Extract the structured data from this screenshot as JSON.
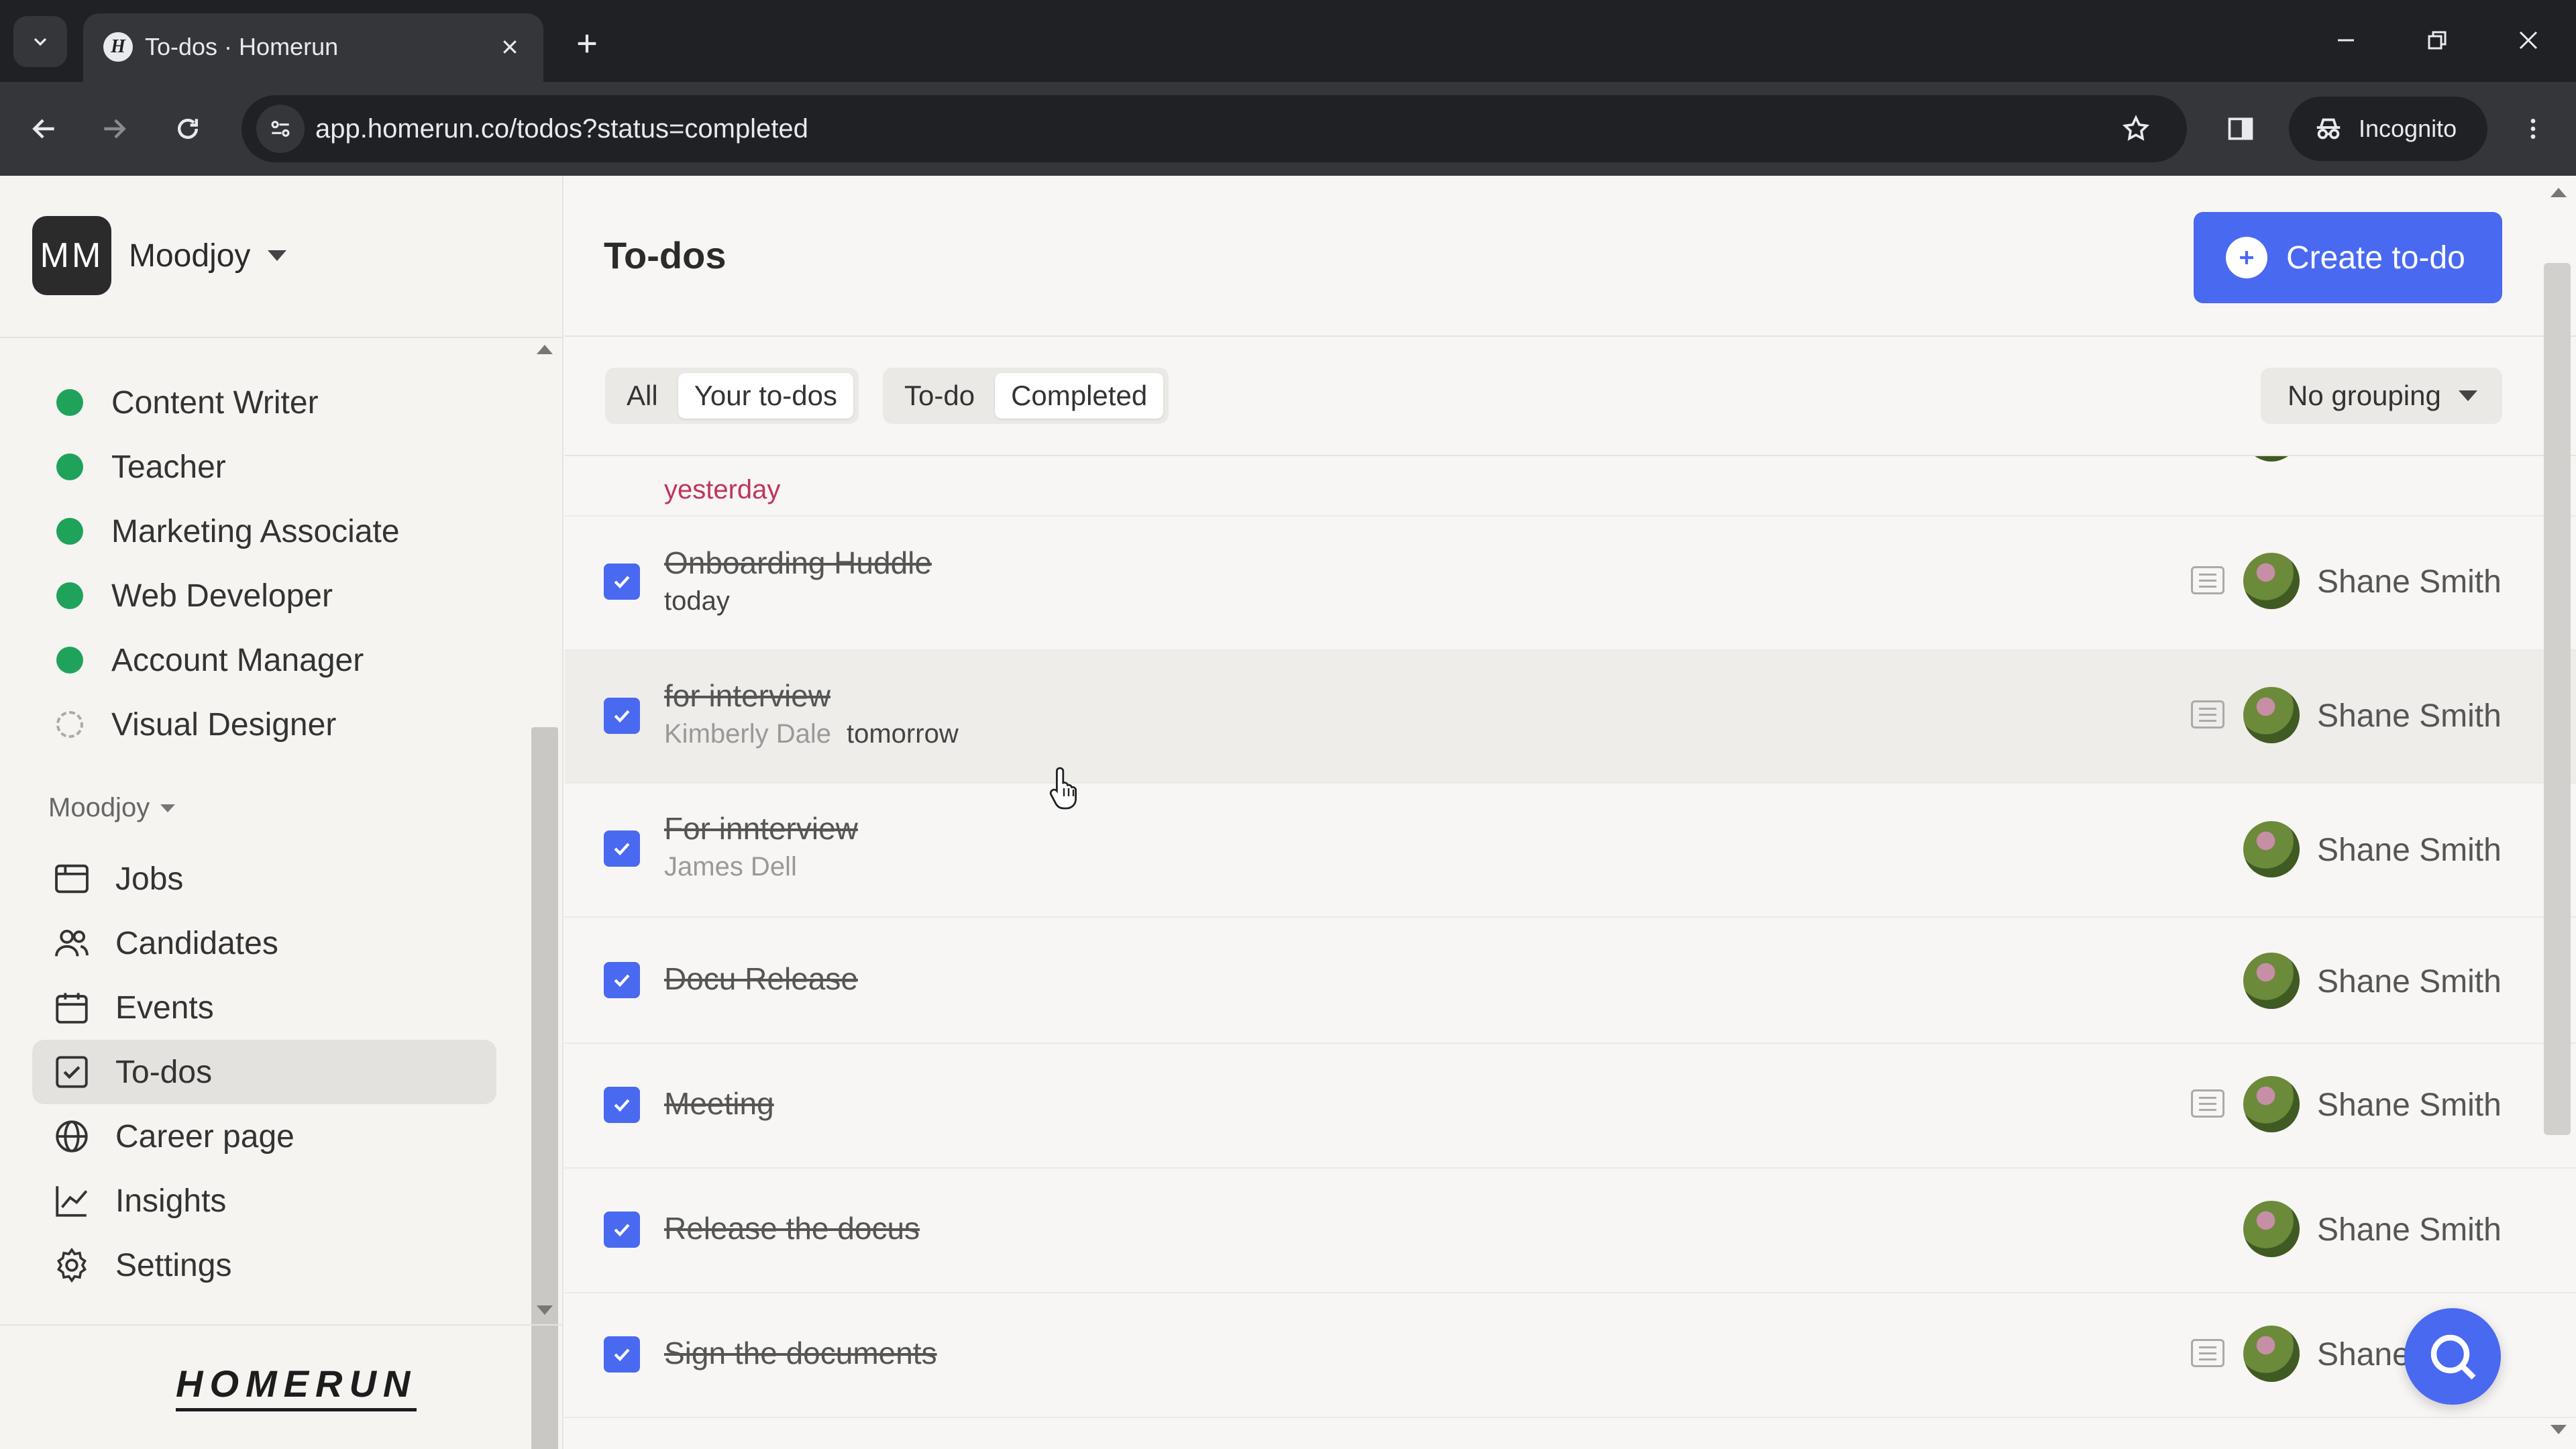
{
  "browser": {
    "tab_title": "To-dos · Homerun",
    "url": "app.homerun.co/todos?status=completed",
    "incognito_label": "Incognito"
  },
  "sidebar": {
    "org_initials": "MM",
    "org_name": "Moodjoy",
    "jobs": [
      {
        "label": "Content Writer",
        "status": "published"
      },
      {
        "label": "Teacher",
        "status": "published"
      },
      {
        "label": "Marketing Associate",
        "status": "published"
      },
      {
        "label": "Web Developer",
        "status": "published"
      },
      {
        "label": "Account Manager",
        "status": "published"
      },
      {
        "label": "Visual Designer",
        "status": "draft"
      }
    ],
    "section_label": "Moodjoy",
    "nav": [
      {
        "label": "Jobs",
        "icon": "briefcase-icon"
      },
      {
        "label": "Candidates",
        "icon": "users-icon"
      },
      {
        "label": "Events",
        "icon": "calendar-icon"
      },
      {
        "label": "To-dos",
        "icon": "checkbox-icon",
        "active": true
      },
      {
        "label": "Career page",
        "icon": "globe-icon"
      },
      {
        "label": "Insights",
        "icon": "chart-line-icon"
      },
      {
        "label": "Settings",
        "icon": "gear-icon"
      }
    ],
    "logo": "HOMERUN"
  },
  "main": {
    "title": "To-dos",
    "create_label": "Create to-do",
    "filters": {
      "scope": [
        "All",
        "Your to-dos"
      ],
      "status": [
        "To-do",
        "Completed"
      ]
    },
    "grouping_label": "No grouping",
    "todos": [
      {
        "title": "",
        "subtitle": "yesterday",
        "assignee": "",
        "has_note": false
      },
      {
        "title": "Onboarding Huddle",
        "subtitle": "today",
        "assignee": "Shane Smith",
        "has_note": true
      },
      {
        "title": "for interview",
        "subtitle_person": "Kimberly Dale",
        "subtitle": "tomorrow",
        "assignee": "Shane Smith",
        "has_note": true
      },
      {
        "title": "For innterview",
        "subtitle_person": "James Dell",
        "subtitle": "",
        "assignee": "Shane Smith",
        "has_note": false
      },
      {
        "title": "Docu Release",
        "subtitle": "",
        "assignee": "Shane Smith",
        "has_note": false
      },
      {
        "title": "Meeting",
        "subtitle": "",
        "assignee": "Shane Smith",
        "has_note": true
      },
      {
        "title": "Release the docus",
        "subtitle": "",
        "assignee": "Shane Smith",
        "has_note": false
      },
      {
        "title": "Sign the documents",
        "subtitle": "",
        "assignee": "Shane",
        "has_note": true
      }
    ]
  },
  "colors": {
    "accent": "#4969f0",
    "published_dot": "#1fa35b",
    "overdue_text": "#c0355a"
  }
}
